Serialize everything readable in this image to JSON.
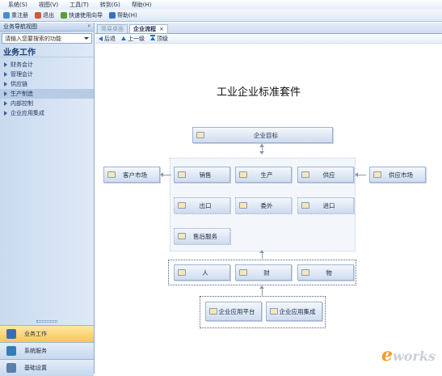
{
  "menu": [
    "系统(S)",
    "视图(V)",
    "工具(T)",
    "转到(G)",
    "帮助(H)"
  ],
  "toolbar": {
    "items": [
      {
        "label": "重注册",
        "icon": "register-icon",
        "color": "#4a8ad0"
      },
      {
        "label": "退出",
        "icon": "exit-icon",
        "color": "#d05a3a"
      },
      {
        "label": "快速使用向导",
        "icon": "wizard-icon",
        "color": "#5d9c3a"
      },
      {
        "label": "帮助(H)",
        "icon": "help-icon",
        "color": "#3a6fc0"
      }
    ]
  },
  "sidebar": {
    "header": "业务导航视图",
    "pin": "ᵖ",
    "search_placeholder": "请输入您要搜索的功能",
    "title": "业务工作",
    "items": [
      "财务会计",
      "管理会计",
      "供应链",
      "生产制造",
      "内部控制",
      "企业应用集成"
    ],
    "active_index": 3,
    "bottom": [
      {
        "label": "业务工作",
        "active": true,
        "color": "#3b6db3"
      },
      {
        "label": "系统服务",
        "active": false,
        "color": "#2f7fb8"
      },
      {
        "label": "基础设置",
        "active": false,
        "color": "#5b7fa8"
      }
    ]
  },
  "tabs": [
    {
      "label": "简易桌面",
      "active": false,
      "closable": false
    },
    {
      "label": "企业流程",
      "active": true,
      "closable": true,
      "close": "×"
    }
  ],
  "nav": {
    "back": "后退",
    "up": "上一级",
    "top": "顶级"
  },
  "diagram": {
    "title": "工业企业标准套件",
    "goal": "企业目标",
    "customer_market": "客户市场",
    "supplier_market": "供应市场",
    "row1": [
      "销售",
      "生产",
      "供应"
    ],
    "row2": [
      "出口",
      "委外",
      "进口"
    ],
    "after_sales": "售后服务",
    "resources": [
      "人",
      "财",
      "物"
    ],
    "integration": [
      "企业应用平台",
      "企业应用集成"
    ]
  },
  "watermark": {
    "e": "e",
    "rest": "works"
  }
}
